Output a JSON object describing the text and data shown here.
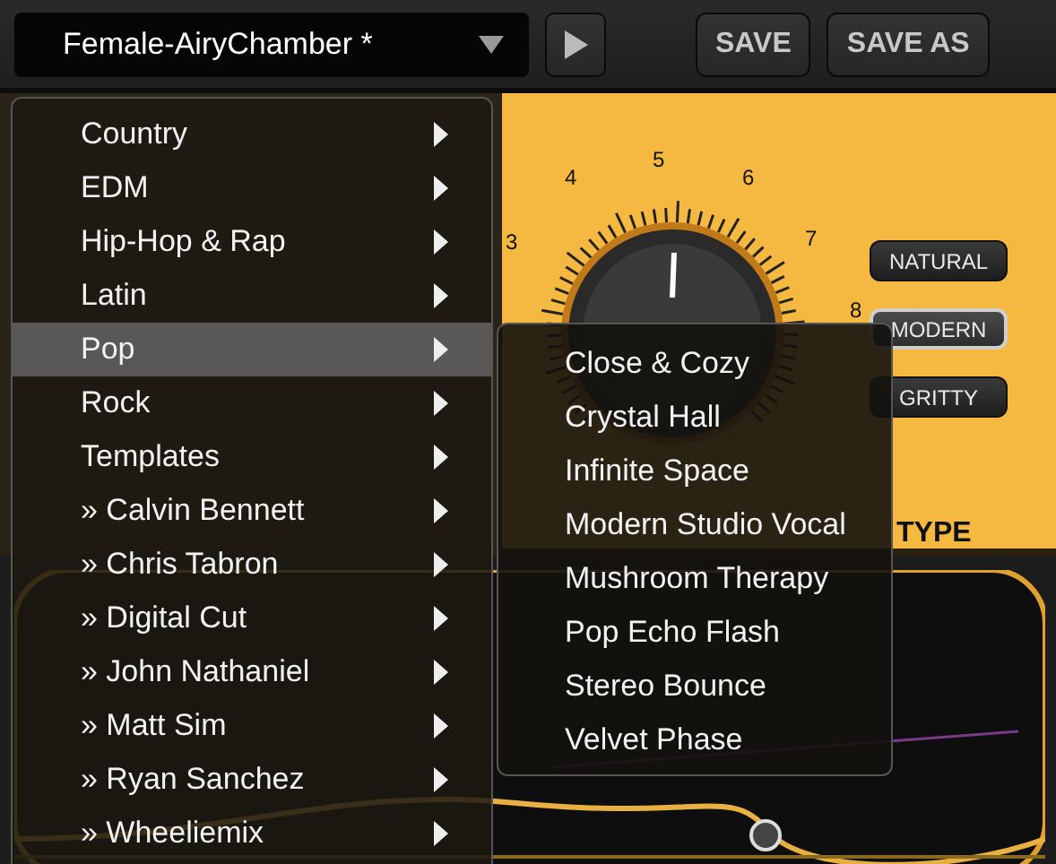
{
  "preset": {
    "name": "Female-AiryChamber *"
  },
  "header_buttons": [
    {
      "label": "SAVE"
    },
    {
      "label": "SAVE AS"
    }
  ],
  "dial": {
    "scale": [
      "3",
      "4",
      "5",
      "6",
      "7",
      "8"
    ]
  },
  "types": [
    {
      "label": "NATURAL",
      "selected": false
    },
    {
      "label": "MODERN",
      "selected": true
    },
    {
      "label": "GRITTY",
      "selected": false
    }
  ],
  "type_label": "TYPE",
  "menu": [
    {
      "label": "Country",
      "selected": false,
      "has_submenu": true
    },
    {
      "label": "EDM",
      "selected": false,
      "has_submenu": true
    },
    {
      "label": "Hip-Hop & Rap",
      "selected": false,
      "has_submenu": true
    },
    {
      "label": "Latin",
      "selected": false,
      "has_submenu": true
    },
    {
      "label": "Pop",
      "selected": true,
      "has_submenu": true
    },
    {
      "label": "Rock",
      "selected": false,
      "has_submenu": true
    },
    {
      "label": "Templates",
      "selected": false,
      "has_submenu": true
    },
    {
      "label": "» Calvin Bennett",
      "selected": false,
      "has_submenu": true
    },
    {
      "label": "» Chris Tabron",
      "selected": false,
      "has_submenu": true
    },
    {
      "label": "» Digital Cut",
      "selected": false,
      "has_submenu": true
    },
    {
      "label": "» John Nathaniel",
      "selected": false,
      "has_submenu": true
    },
    {
      "label": "» Matt Sim",
      "selected": false,
      "has_submenu": true
    },
    {
      "label": "» Ryan Sanchez",
      "selected": false,
      "has_submenu": true
    },
    {
      "label": "» Wheeliemix",
      "selected": false,
      "has_submenu": true
    }
  ],
  "submenu": [
    {
      "label": "Close & Cozy",
      "selected": false
    },
    {
      "label": "Crystal Hall",
      "selected": false
    },
    {
      "label": "Infinite Space",
      "selected": false
    },
    {
      "label": "Modern Studio Vocal",
      "selected": false
    },
    {
      "label": "Mushroom Therapy",
      "selected": false
    },
    {
      "label": "Pop Echo Flash",
      "selected": false
    },
    {
      "label": "Stereo Bounce",
      "selected": false
    },
    {
      "label": "Velvet Phase",
      "selected": false
    }
  ]
}
